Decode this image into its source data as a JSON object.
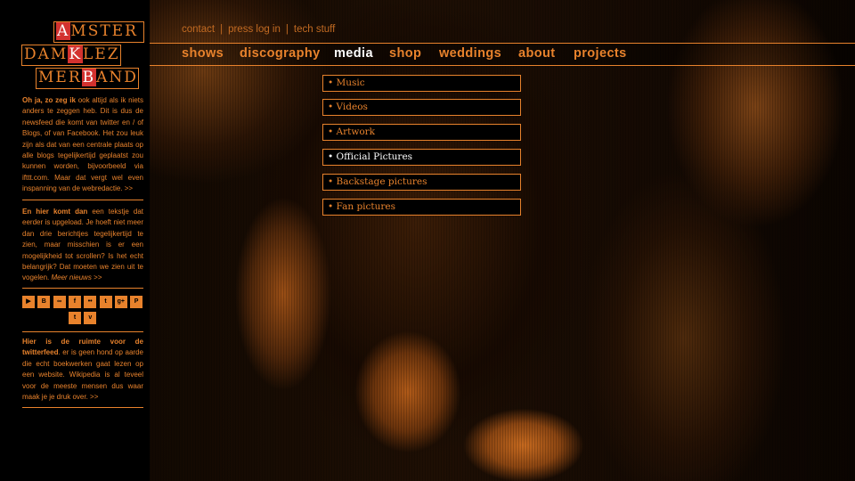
{
  "logo": {
    "row1_hl": "A",
    "row1_rest": "MSTER",
    "row2_a": "DAM",
    "row2_hl": "K",
    "row2_b": "LEZ",
    "row3_a": "MER",
    "row3_hl": "B",
    "row3_b": "AND"
  },
  "top_links": [
    "contact",
    "press log in",
    "tech stuff"
  ],
  "top_sep": "|",
  "nav": [
    "shows",
    "discography",
    "media",
    "shop",
    "weddings",
    "about",
    "projects"
  ],
  "media_menu": [
    "• Music",
    "• Videos",
    "• Artwork",
    "• Official Pictures",
    "• Backstage pictures",
    "• Fan pictures"
  ],
  "news1": {
    "bold": "Oh ja, zo zeg ik",
    "text": " ook altijd als ik niets anders te zeggen heb. Dit is dus de newsfeed die komt van twitter en / of Blogs, of van Facebook. Het zou leuk zijn als dat van een centrale plaats op alle blogs tegelijkertijd geplaatst zou kunnen worden, bijvoorbeeld via ifttt.com. Maar dat vergt wel even inspanning van de webredactie. >>"
  },
  "news2": {
    "bold": "En hier komt dan",
    "text": " een tekstje dat eerder is upgeload. Je hoeft niet meer dan drie berichtjes tegelijkertijd te zien, maar misschien is er een mogelijkheid tot scrollen? Is het echt belangrijk? Dat moeten we zien uit te vogelen. ",
    "more": "Meer nieuws >>"
  },
  "socials": [
    "youtube-icon",
    "blogger-icon",
    "lastfm-icon",
    "facebook-icon",
    "flickr-icon",
    "tumblr-icon",
    "google-plus-icon",
    "pinterest-icon",
    "twitter-icon",
    "vimeo-icon"
  ],
  "social_glyphs": [
    "▶",
    "B",
    "∞",
    "f",
    "••",
    "t",
    "g+",
    "P",
    "t",
    "v"
  ],
  "twitter": {
    "bold": "Hier is de ruimte voor de twitterfeed",
    "text": ". er is geen hond op aarde die echt boekwerken gaat lezen op een website. Wikipedia is al teveel voor de meeste mensen dus waar maak je je druk over. >>"
  },
  "colors": {
    "accent": "#e8822c",
    "logo_highlight": "#d3322f",
    "active": "#ffffff"
  }
}
